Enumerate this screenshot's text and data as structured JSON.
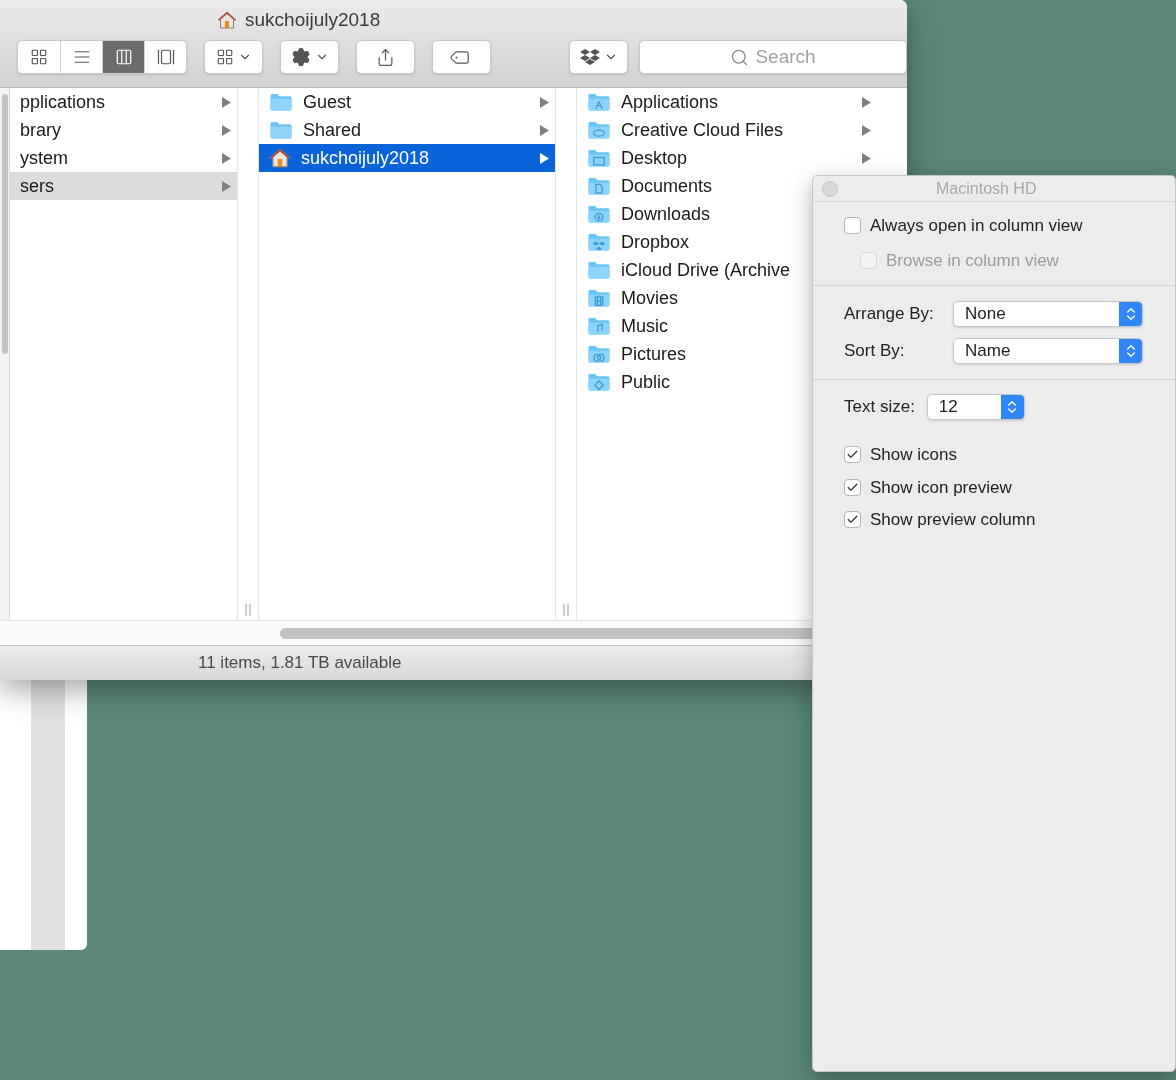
{
  "window": {
    "title": "sukchoijuly2018"
  },
  "toolbar": {
    "view_buttons": [
      {
        "kind": "icons",
        "selected": false
      },
      {
        "kind": "list",
        "selected": false
      },
      {
        "kind": "columns",
        "selected": true
      },
      {
        "kind": "gallery",
        "selected": false
      }
    ],
    "search": {
      "placeholder": "Search"
    }
  },
  "columns": [
    {
      "active": false,
      "items": [
        {
          "name": "pplications",
          "kind": "none",
          "selected": false,
          "has_children": true
        },
        {
          "name": "brary",
          "kind": "none",
          "selected": false,
          "has_children": true
        },
        {
          "name": "ystem",
          "kind": "none",
          "selected": false,
          "has_children": true
        },
        {
          "name": "sers",
          "kind": "none",
          "selected": true,
          "has_children": true
        }
      ]
    },
    {
      "active": true,
      "items": [
        {
          "name": "Guest",
          "kind": "folder",
          "selected": false,
          "has_children": true
        },
        {
          "name": "Shared",
          "kind": "folder",
          "selected": false,
          "has_children": true
        },
        {
          "name": "sukchoijuly2018",
          "kind": "home",
          "selected": true,
          "has_children": true
        }
      ]
    },
    {
      "items": [
        {
          "name": "Applications",
          "kind": "apps",
          "selected": false,
          "has_children": true
        },
        {
          "name": "Creative Cloud Files",
          "kind": "cloud",
          "selected": false,
          "has_children": true
        },
        {
          "name": "Desktop",
          "kind": "desktop",
          "selected": false,
          "has_children": true
        },
        {
          "name": "Documents",
          "kind": "document",
          "selected": false
        },
        {
          "name": "Downloads",
          "kind": "download",
          "selected": false
        },
        {
          "name": "Dropbox",
          "kind": "dropbox",
          "selected": false
        },
        {
          "name": "iCloud Drive (Archive",
          "kind": "folder",
          "selected": false
        },
        {
          "name": "Movies",
          "kind": "movies",
          "selected": false
        },
        {
          "name": "Music",
          "kind": "music",
          "selected": false
        },
        {
          "name": "Pictures",
          "kind": "pictures",
          "selected": false
        },
        {
          "name": "Public",
          "kind": "public",
          "selected": false
        }
      ]
    }
  ],
  "status_bar": "11 items, 1.81 TB available",
  "view_options": {
    "title": "Macintosh HD",
    "checkboxes_top": [
      {
        "label": "Always open in column view",
        "checked": false,
        "disabled": false
      },
      {
        "label": "Browse in column view",
        "checked": false,
        "disabled": true
      }
    ],
    "popups": [
      {
        "label": "Arrange By:",
        "value": "None"
      },
      {
        "label": "Sort By:",
        "value": "Name"
      }
    ],
    "text_size": {
      "label": "Text size:",
      "value": "12"
    },
    "checkboxes_bottom": [
      {
        "label": "Show icons",
        "checked": true,
        "disabled": false
      },
      {
        "label": "Show icon preview",
        "checked": true,
        "disabled": false
      },
      {
        "label": "Show preview column",
        "checked": true,
        "disabled": false
      }
    ]
  }
}
